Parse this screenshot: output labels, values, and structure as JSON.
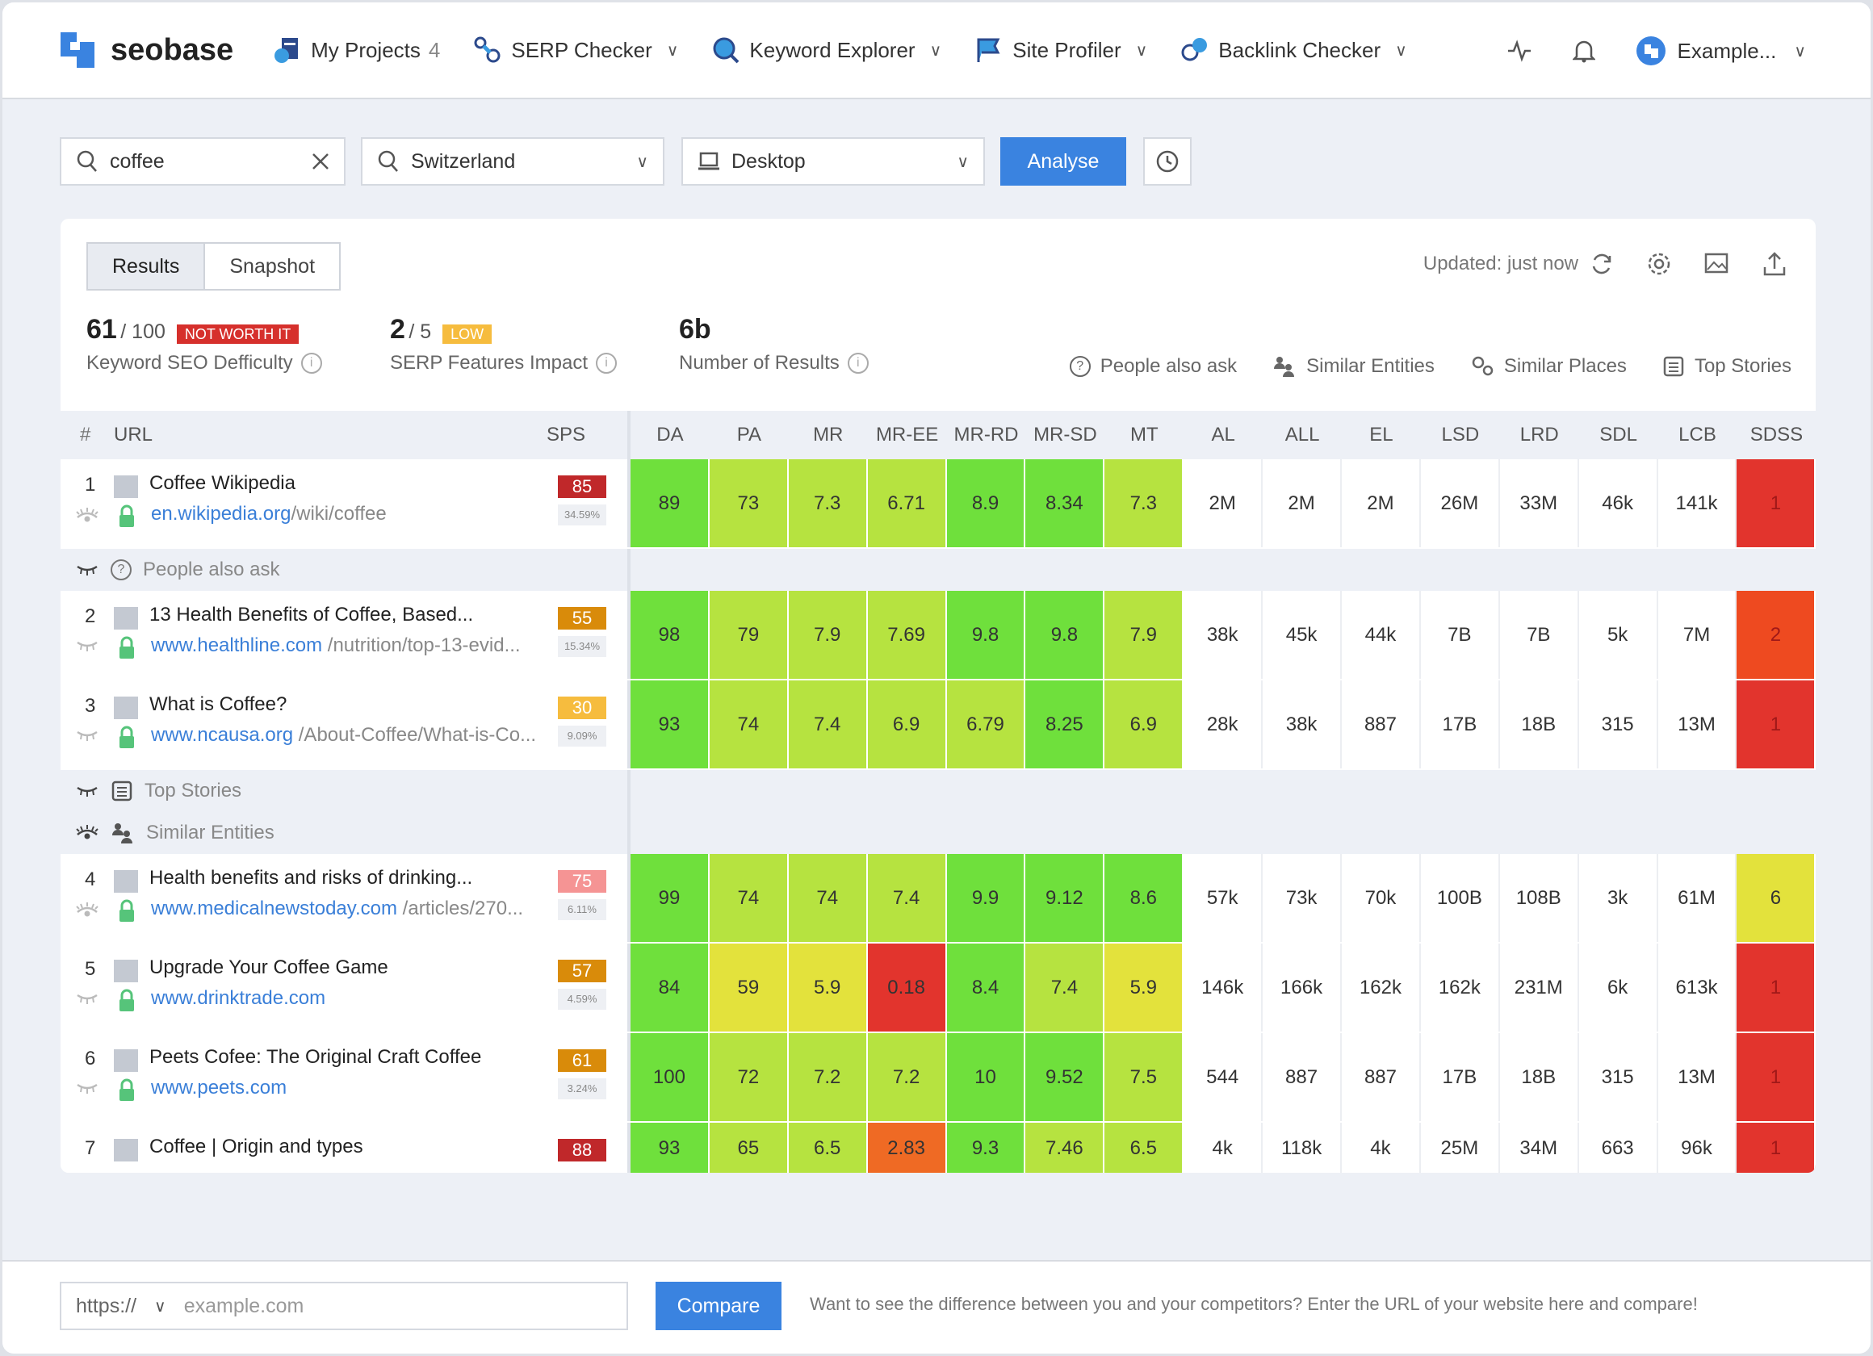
{
  "nav": {
    "brand": "seobase",
    "items": [
      {
        "label": "My Projects",
        "count": "4"
      },
      {
        "label": "SERP Checker"
      },
      {
        "label": "Keyword Explorer"
      },
      {
        "label": "Site Profiler"
      },
      {
        "label": "Backlink Checker"
      }
    ],
    "account": "Example..."
  },
  "search": {
    "keyword": "coffee",
    "country": "Switzerland",
    "device": "Desktop",
    "analyse": "Analyse"
  },
  "tabs": [
    "Results",
    "Snapshot"
  ],
  "updated": "Updated: just now",
  "stats": {
    "kd_value": "61",
    "kd_of": "/ 100",
    "kd_badge": "NOT WORTH IT",
    "kd_label": "Keyword SEO Defficulty",
    "sf_value": "2",
    "sf_of": "/ 5",
    "sf_badge": "LOW",
    "sf_label": "SERP Features Impact",
    "nr_value": "6b",
    "nr_label": "Number of Results"
  },
  "features": [
    "People also ask",
    "Similar Entities",
    "Similar Places",
    "Top Stories"
  ],
  "columns": {
    "hash": "#",
    "url": "URL",
    "sps": "SPS",
    "metrics": [
      "DA",
      "PA",
      "MR",
      "MR-EE",
      "MR-RD",
      "MR-SD",
      "MT",
      "AL",
      "ALL",
      "EL",
      "LSD",
      "LRD",
      "SDL",
      "LCB",
      "SDSS"
    ]
  },
  "colors": {
    "g": "#6fe03c",
    "yg": "#b6e340",
    "y": "#e3e23c",
    "r": "#e2342d",
    "or": "#ee4a20",
    "o": "#ef6a24",
    "sps_darkred": "#c0282a",
    "sps_amber": "#d98b0a",
    "sps_yellow": "#f6bc3e",
    "sps_pink": "#f59494",
    "link": "#3a7fd8",
    "accent": "#3a83e0"
  },
  "rows": [
    {
      "type": "result",
      "n": "1",
      "title": "Coffee Wikipedia",
      "domain": "en.wikipedia.org",
      "path": "/wiki/coffee",
      "sps": "85",
      "sps_color": "sps_darkred",
      "pct": "34.59%",
      "eye": "open",
      "values": [
        "89",
        "73",
        "7.3",
        "6.71",
        "8.9",
        "8.34",
        "7.3",
        "2M",
        "2M",
        "2M",
        "26M",
        "33M",
        "46k",
        "141k",
        "1"
      ],
      "levels": [
        "g",
        "yg",
        "yg",
        "yg",
        "g",
        "g",
        "yg",
        "",
        "",
        "",
        "",
        "",
        "",
        "",
        "r"
      ]
    },
    {
      "type": "feature",
      "label": "People also ask",
      "icon": "question",
      "eye": "closed"
    },
    {
      "type": "result",
      "n": "2",
      "title": "13 Health Benefits of Coffee, Based...",
      "domain": "www.healthline.com",
      "path": " /nutrition/top-13-evid...",
      "sps": "55",
      "sps_color": "sps_amber",
      "pct": "15.34%",
      "eye": "closed",
      "values": [
        "98",
        "79",
        "7.9",
        "7.69",
        "9.8",
        "9.8",
        "7.9",
        "38k",
        "45k",
        "44k",
        "7B",
        "7B",
        "5k",
        "7M",
        "2"
      ],
      "levels": [
        "g",
        "yg",
        "yg",
        "yg",
        "g",
        "g",
        "yg",
        "",
        "",
        "",
        "",
        "",
        "",
        "",
        "or"
      ]
    },
    {
      "type": "result",
      "n": "3",
      "title": "What is Coffee?",
      "domain": "www.ncausa.org",
      "path": " /About-Coffee/What-is-Co...",
      "sps": "30",
      "sps_color": "sps_yellow",
      "pct": "9.09%",
      "eye": "closed",
      "values": [
        "93",
        "74",
        "7.4",
        "6.9",
        "6.79",
        "8.25",
        "6.9",
        "28k",
        "38k",
        "887",
        "17B",
        "18B",
        "315",
        "13M",
        "1"
      ],
      "levels": [
        "g",
        "yg",
        "yg",
        "yg",
        "yg",
        "g",
        "yg",
        "",
        "",
        "",
        "",
        "",
        "",
        "",
        "r"
      ]
    },
    {
      "type": "feature",
      "label": "Top Stories",
      "icon": "news",
      "eye": "closed"
    },
    {
      "type": "feature",
      "label": "Similar Entities",
      "icon": "people",
      "eye": "open"
    },
    {
      "type": "result",
      "n": "4",
      "title": "Health benefits and risks of drinking...",
      "domain": "www.medicalnewstoday.com",
      "path": " /articles/270...",
      "sps": "75",
      "sps_color": "sps_pink",
      "pct": "6.11%",
      "eye": "open",
      "values": [
        "99",
        "74",
        "74",
        "7.4",
        "9.9",
        "9.12",
        "8.6",
        "57k",
        "73k",
        "70k",
        "100B",
        "108B",
        "3k",
        "61M",
        "6"
      ],
      "levels": [
        "g",
        "yg",
        "yg",
        "yg",
        "g",
        "g",
        "g",
        "",
        "",
        "",
        "",
        "",
        "",
        "",
        "y"
      ]
    },
    {
      "type": "result",
      "n": "5",
      "title": "Upgrade Your Coffee Game",
      "domain": "www.drinktrade.com",
      "path": "",
      "sps": "57",
      "sps_color": "sps_amber",
      "pct": "4.59%",
      "eye": "closed",
      "values": [
        "84",
        "59",
        "5.9",
        "0.18",
        "8.4",
        "7.4",
        "5.9",
        "146k",
        "166k",
        "162k",
        "162k",
        "231M",
        "6k",
        "613k",
        "1"
      ],
      "levels": [
        "g",
        "y",
        "y",
        "r",
        "g",
        "yg",
        "y",
        "",
        "",
        "",
        "",
        "",
        "",
        "",
        "r"
      ]
    },
    {
      "type": "result",
      "n": "6",
      "title": "Peets Cofee: The Original Craft Coffee",
      "domain": "www.peets.com",
      "path": "",
      "sps": "61",
      "sps_color": "sps_amber",
      "pct": "3.24%",
      "eye": "closed",
      "values": [
        "100",
        "72",
        "7.2",
        "7.2",
        "10",
        "9.52",
        "7.5",
        "544",
        "887",
        "887",
        "17B",
        "18B",
        "315",
        "13M",
        "1"
      ],
      "levels": [
        "g",
        "yg",
        "yg",
        "yg",
        "g",
        "g",
        "yg",
        "",
        "",
        "",
        "",
        "",
        "",
        "",
        "r"
      ]
    },
    {
      "type": "result",
      "n": "7",
      "title": "Coffee | Origin and types",
      "domain": "",
      "path": "",
      "sps": "88",
      "sps_color": "sps_darkred",
      "pct": "",
      "eye": "open",
      "values": [
        "93",
        "65",
        "6.5",
        "2.83",
        "9.3",
        "7.46",
        "6.5",
        "4k",
        "118k",
        "4k",
        "25M",
        "34M",
        "663",
        "96k",
        "1"
      ],
      "levels": [
        "g",
        "yg",
        "yg",
        "o",
        "g",
        "yg",
        "yg",
        "",
        "",
        "",
        "",
        "",
        "",
        "",
        "r"
      ]
    }
  ],
  "footer": {
    "protocol": "https://",
    "placeholder": "example.com",
    "compare": "Compare",
    "hint": "Want to see the difference between you and your competitors? Enter the URL of your website here and compare!"
  }
}
